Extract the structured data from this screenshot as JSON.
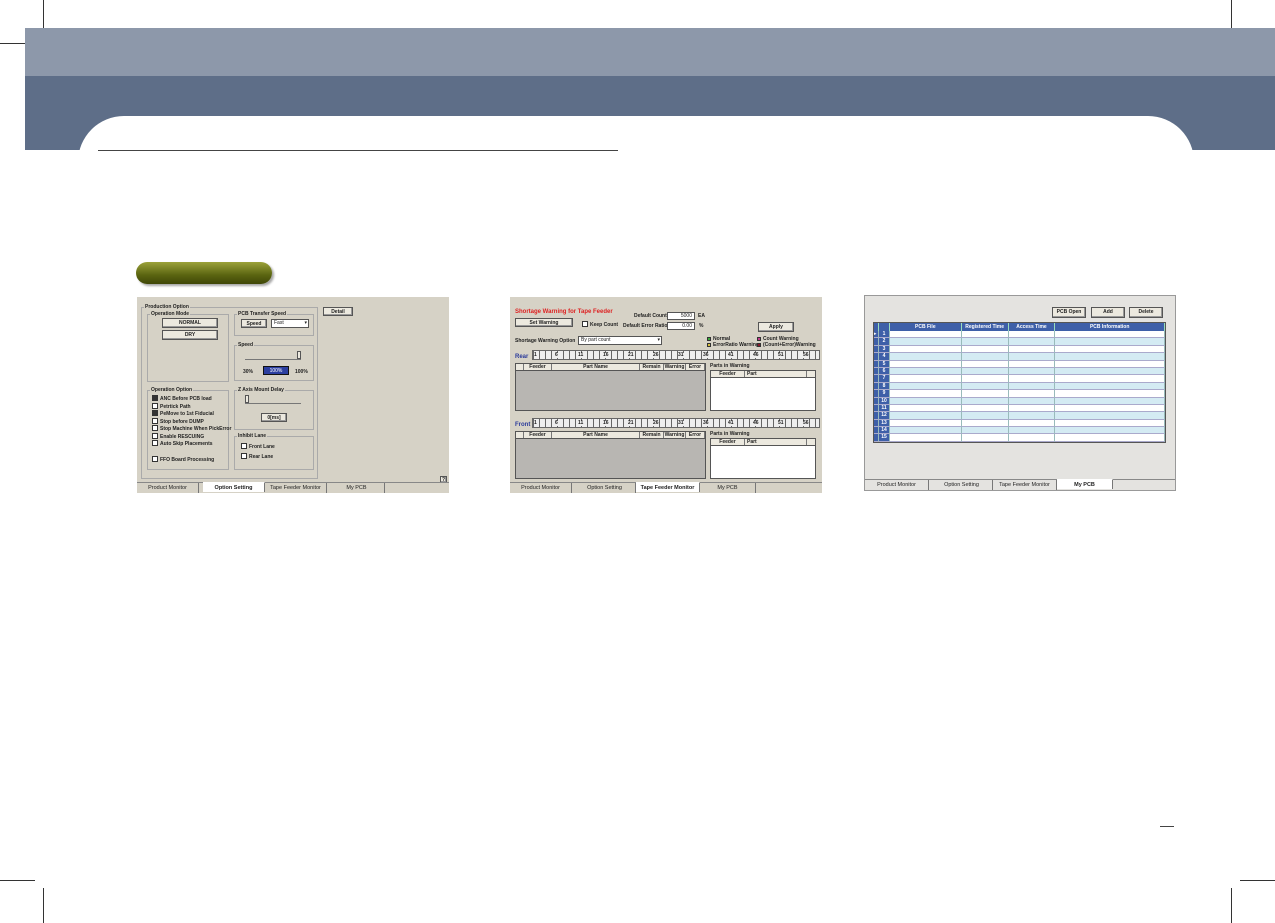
{
  "screens": {
    "option_setting": {
      "production_option_title": "Production Option",
      "operation_mode_title": "Operation Mode",
      "normal_btn": "NORMAL",
      "dry_btn": "DRY",
      "pcb_transfer_title": "PCB Transfer Speed",
      "speed_label": "Speed",
      "speed_value": "Fast",
      "speed_group_title": "Speed",
      "speed_min": "30%",
      "speed_current": "100%",
      "speed_max": "100%",
      "detail_btn": "Detail",
      "operation_option_title": "Operation Option",
      "options": [
        {
          "label": "ANC Before PCB load",
          "checked": true
        },
        {
          "label": "Petrtick Path",
          "checked": false
        },
        {
          "label": "PeMove to 1st Fiducial",
          "checked": true
        },
        {
          "label": "Stop before DUMP",
          "checked": false
        },
        {
          "label": "Stop Machine When PickError",
          "checked": false
        },
        {
          "label": "Enable RESCUING",
          "checked": false
        },
        {
          "label": "Auto Skip Placements",
          "checked": false
        },
        {
          "label": "FFO Board Processing",
          "checked": false
        }
      ],
      "zaxis_title": "Z Axis Mount Delay",
      "zaxis_value": "0[ms]",
      "inhibit_title": "Inhibit Lane",
      "front_lane": "Front Lane",
      "rear_lane": "Rear Lane",
      "help_glyph": "?"
    },
    "tape_feeder": {
      "title": "Shortage Warning for Tape Feeder",
      "set_warning_btn": "Set Warning",
      "keep_count": "Keep Count",
      "default_count_label": "Default Count",
      "default_count_value": "5000",
      "default_count_unit": "EA",
      "default_error_label": "Default Error Ratio",
      "default_error_value": "0.00",
      "default_error_unit": "%",
      "apply_btn": "Apply",
      "option_label": "Shortage Warning Option",
      "option_value": "By part count",
      "legend": [
        {
          "label": "Normal",
          "color": "#3aa83a"
        },
        {
          "label": "Count Warning",
          "color": "#c23a8a"
        },
        {
          "label": "ErrorRatio Warning",
          "color": "#d8c040"
        },
        {
          "label": "(Count+Error)Warning",
          "color": "#8a1a2a"
        }
      ],
      "rear_label": "Rear",
      "front_label": "Front",
      "ruler_ticks": [
        "1",
        "6",
        "11",
        "16",
        "21",
        "26",
        "31",
        "36",
        "41",
        "46",
        "51",
        "56"
      ],
      "columns": [
        "Feeder",
        "Part Name",
        "Remain",
        "Warning",
        "Error"
      ],
      "parts_in_warning": "Parts in Warning",
      "pw_columns": [
        "Feeder",
        "Part"
      ]
    },
    "my_pcb": {
      "buttons": [
        "PCB Open",
        "Add",
        "Delete"
      ],
      "columns": [
        "PCB File",
        "Registered Time",
        "Access Time",
        "PCB Information"
      ],
      "row_numbers": [
        "1",
        "2",
        "3",
        "4",
        "5",
        "6",
        "7",
        "8",
        "9",
        "10",
        "11",
        "12",
        "13",
        "14",
        "15"
      ]
    }
  },
  "tabs": [
    "Product Monitor",
    "Option Setting",
    "Tape Feeder Monitor",
    "My PCB"
  ],
  "colors": {
    "header_light": "#8d98aa",
    "header_dark": "#5e6e88",
    "pill": "#5a6410",
    "pcb_blue": "#3e5fa8"
  }
}
